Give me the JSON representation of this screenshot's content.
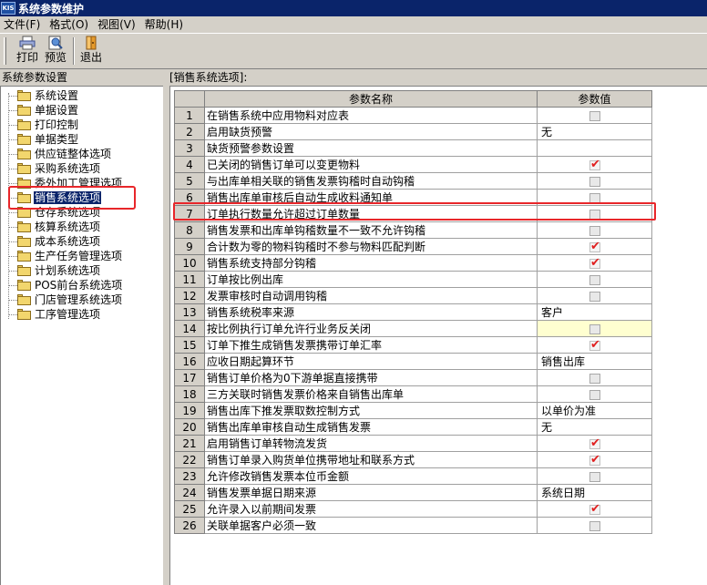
{
  "window": {
    "title": "系统参数维护",
    "icon_text": "KIS"
  },
  "menu": [
    "文件(F)",
    "格式(O)",
    "视图(V)",
    "帮助(H)"
  ],
  "toolbar": {
    "print": "打印",
    "preview": "预览",
    "exit": "退出"
  },
  "left_panel": {
    "header": "系统参数设置",
    "items": [
      "系统设置",
      "单据设置",
      "打印控制",
      "单据类型",
      "供应链整体选项",
      "采购系统选项",
      "委外加工管理选项",
      "销售系统选项",
      "仓存系统选项",
      "核算系统选项",
      "成本系统选项",
      "生产任务管理选项",
      "计划系统选项",
      "POS前台系统选项",
      "门店管理系统选项",
      "工序管理选项"
    ],
    "selected_index": 7
  },
  "right_panel": {
    "header": "[销售系统选项]:",
    "columns": [
      "参数名称",
      "参数值"
    ],
    "rows": [
      {
        "no": "1",
        "name": "在销售系统中应用物料对应表",
        "type": "check",
        "checked": false
      },
      {
        "no": "2",
        "name": "启用缺货预警",
        "type": "text",
        "value": "无"
      },
      {
        "no": "3",
        "name": "缺货预警参数设置",
        "type": "empty"
      },
      {
        "no": "4",
        "name": "已关闭的销售订单可以变更物料",
        "type": "check",
        "checked": true
      },
      {
        "no": "5",
        "name": "与出库单相关联的销售发票钩稽时自动钩稽",
        "type": "check",
        "checked": false
      },
      {
        "no": "6",
        "name": "销售出库单审核后自动生成收料通知单",
        "type": "check",
        "checked": false
      },
      {
        "no": "7",
        "name": "订单执行数量允许超过订单数量",
        "type": "check",
        "checked": false
      },
      {
        "no": "8",
        "name": "销售发票和出库单钩稽数量不一致不允许钩稽",
        "type": "check",
        "checked": false
      },
      {
        "no": "9",
        "name": "合计数为零的物料钩稽时不参与物料匹配判断",
        "type": "check",
        "checked": true
      },
      {
        "no": "10",
        "name": "销售系统支持部分钩稽",
        "type": "check",
        "checked": true
      },
      {
        "no": "11",
        "name": "订单按比例出库",
        "type": "check",
        "checked": false
      },
      {
        "no": "12",
        "name": "发票审核时自动调用钩稽",
        "type": "check",
        "checked": false
      },
      {
        "no": "13",
        "name": "销售系统税率来源",
        "type": "text",
        "value": "客户"
      },
      {
        "no": "14",
        "name": "按比例执行订单允许行业务反关闭",
        "type": "check",
        "checked": false,
        "highlight": true
      },
      {
        "no": "15",
        "name": "订单下推生成销售发票携带订单汇率",
        "type": "check",
        "checked": true
      },
      {
        "no": "16",
        "name": "应收日期起算环节",
        "type": "text",
        "value": "销售出库"
      },
      {
        "no": "17",
        "name": "销售订单价格为0下游单据直接携带",
        "type": "check",
        "checked": false
      },
      {
        "no": "18",
        "name": "三方关联时销售发票价格来自销售出库单",
        "type": "check",
        "checked": false
      },
      {
        "no": "19",
        "name": "销售出库下推发票取数控制方式",
        "type": "text",
        "value": "以单价为准"
      },
      {
        "no": "20",
        "name": "销售出库单审核自动生成销售发票",
        "type": "text",
        "value": "无"
      },
      {
        "no": "21",
        "name": "启用销售订单转物流发货",
        "type": "check",
        "checked": true
      },
      {
        "no": "22",
        "name": "销售订单录入购货单位携带地址和联系方式",
        "type": "check",
        "checked": true
      },
      {
        "no": "23",
        "name": "允许修改销售发票本位币金额",
        "type": "check",
        "checked": false
      },
      {
        "no": "24",
        "name": "销售发票单据日期来源",
        "type": "text",
        "value": "系统日期"
      },
      {
        "no": "25",
        "name": "允许录入以前期间发票",
        "type": "check",
        "checked": true
      },
      {
        "no": "26",
        "name": "关联单据客户必须一致",
        "type": "check",
        "checked": false
      }
    ]
  },
  "colors": {
    "accent": "#0a246a",
    "highlight": "#e8262a",
    "check": "#e02020",
    "yellow": "#ffffd0"
  },
  "icons": {
    "print": "printer-icon",
    "preview": "preview-icon",
    "exit": "exit-door-icon",
    "folder": "folder-icon"
  }
}
